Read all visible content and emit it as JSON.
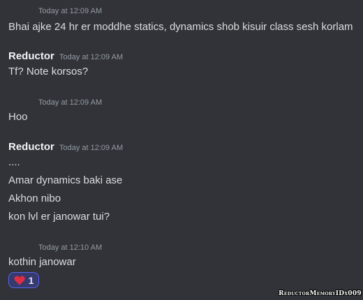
{
  "messages": [
    {
      "timestamp": "Today at 12:09 AM",
      "lines": [
        "Bhai ajke 24 hr er moddhe statics, dynamics shob kisuir class sesh korlam"
      ]
    },
    {
      "author": "Reductor",
      "timestamp": "Today at 12:09 AM",
      "lines": [
        "Tf? Note korsos?"
      ]
    },
    {
      "timestamp": "Today at 12:09 AM",
      "lines": [
        "Hoo"
      ]
    },
    {
      "author": "Reductor",
      "timestamp": "Today at 12:09 AM",
      "lines": [
        "....",
        "Amar dynamics baki ase",
        "Akhon nibo",
        "kon lvl er janowar tui?"
      ]
    },
    {
      "timestamp": "Today at 12:10 AM",
      "lines": [
        "kothin janowar"
      ],
      "reaction": {
        "emoji": "heart-icon",
        "count": "1",
        "color": "#dd2e44"
      }
    }
  ],
  "watermark": "ReductorMemoryIDx009",
  "colors": {
    "background": "#313338",
    "timestamp": "#949ba4",
    "author": "#f2f3f5",
    "text": "#dbdee1",
    "reaction_border": "#5865f2",
    "reaction_bg": "#373a6d"
  }
}
